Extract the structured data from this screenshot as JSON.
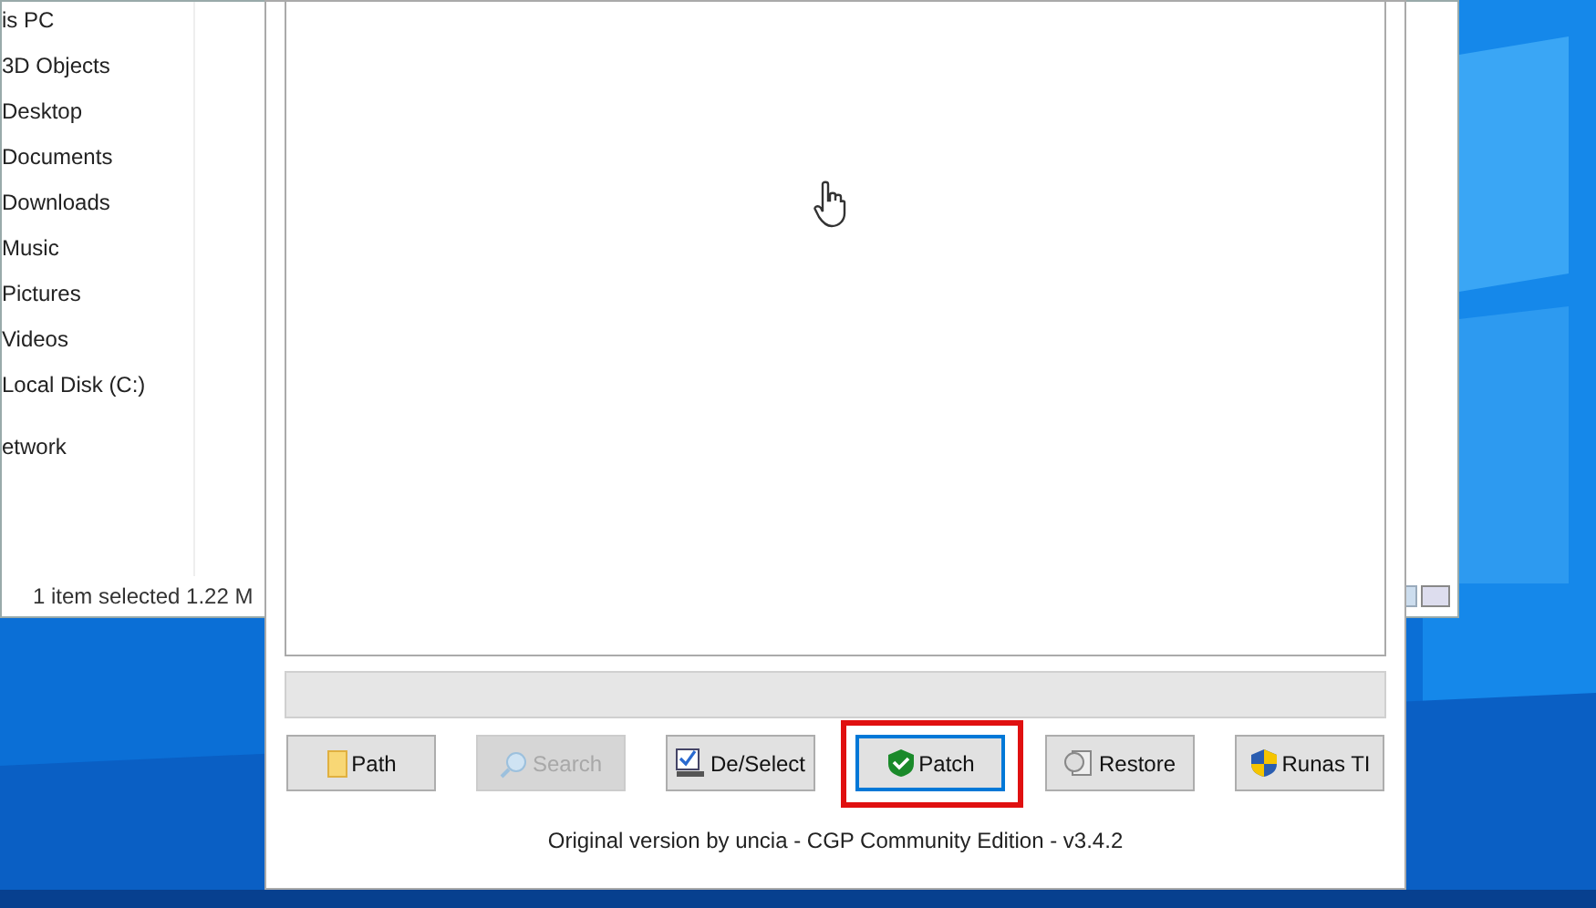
{
  "explorer": {
    "nav_items": [
      "is PC",
      "3D Objects",
      "Desktop",
      "Documents",
      "Downloads",
      "Music",
      "Pictures",
      "Videos",
      "Local Disk (C:)",
      "etwork"
    ],
    "status_bar": "1 item selected  1.22 M"
  },
  "dialog": {
    "buttons": [
      {
        "label": "Path",
        "kind": "folder",
        "disabled": false,
        "focused": false,
        "highlighted": false
      },
      {
        "label": "Search",
        "kind": "search",
        "disabled": true,
        "focused": false,
        "highlighted": false
      },
      {
        "label": "De/Select",
        "kind": "checklist",
        "disabled": false,
        "focused": false,
        "highlighted": false
      },
      {
        "label": "Patch",
        "kind": "shield",
        "disabled": false,
        "focused": true,
        "highlighted": true
      },
      {
        "label": "Restore",
        "kind": "restore",
        "disabled": false,
        "focused": false,
        "highlighted": false
      },
      {
        "label": "Runas TI",
        "kind": "uac",
        "disabled": false,
        "focused": false,
        "highlighted": false
      }
    ],
    "footer": "Original version by uncia - CGP Community Edition - v3.4.2"
  }
}
